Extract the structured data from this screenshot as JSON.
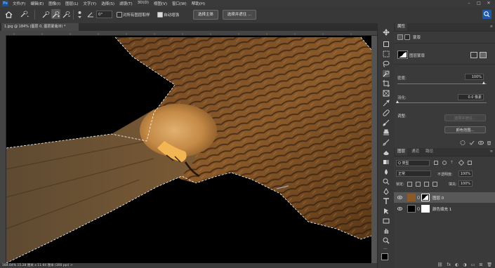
{
  "menubar": {
    "logo": "Ps",
    "items": [
      "文件(F)",
      "编辑(E)",
      "图像(I)",
      "图层(L)",
      "文字(Y)",
      "选择(S)",
      "滤镜(T)",
      "3D(D)",
      "视图(V)",
      "窗口(W)",
      "帮助(H)"
    ],
    "min": "–",
    "max": "□",
    "close": "✕"
  },
  "options": {
    "angle_value": "0°",
    "sample_all_layers_label": "对所有图层取样",
    "sample_all_layers_checked": false,
    "auto_enhance_label": "自动增强",
    "auto_enhance_checked": true,
    "select_subject_button": "选择主体",
    "select_and_mask_button": "选择并遮住 ..."
  },
  "document": {
    "tab_title": "1.jpg @ 184% (图层 0, 图层蒙版/8) *",
    "status": "184.04%   15.28 厘米 x 11.64 厘米 (300 ppi)   >"
  },
  "properties": {
    "tab_label": "属性",
    "mask_section_label": "蒙版",
    "layer_mask_label": "图层蒙版",
    "density_label": "密度:",
    "density_value": "100%",
    "feather_label": "羽化:",
    "feather_value": "0.0 像素",
    "adjust_label": "调整:",
    "select_and_mask_button": "选择并遮住...",
    "color_range_button": "颜色范围..."
  },
  "layers": {
    "tabs": [
      "图层",
      "通道",
      "路径"
    ],
    "filter_kind": "Q 类型",
    "blend_mode": "正常",
    "opacity_label": "不透明度:",
    "opacity_value": "100%",
    "lock_label": "锁定:",
    "fill_label": "填充:",
    "fill_value": "100%",
    "items": [
      {
        "name": "图层 0",
        "selected": true
      },
      {
        "name": "颜色填充 1",
        "selected": false
      }
    ],
    "bottom_icons": [
      "link-icon",
      "fx-icon",
      "mask-icon",
      "adjustment-icon",
      "folder-icon",
      "new-layer-icon",
      "trash-icon"
    ]
  },
  "colors": {
    "foreground": "#000000",
    "background": "#ffffff",
    "bird_primary": "#8a5a2a",
    "bird_dark": "#3a2412",
    "bird_highlight": "#d9a25a"
  }
}
